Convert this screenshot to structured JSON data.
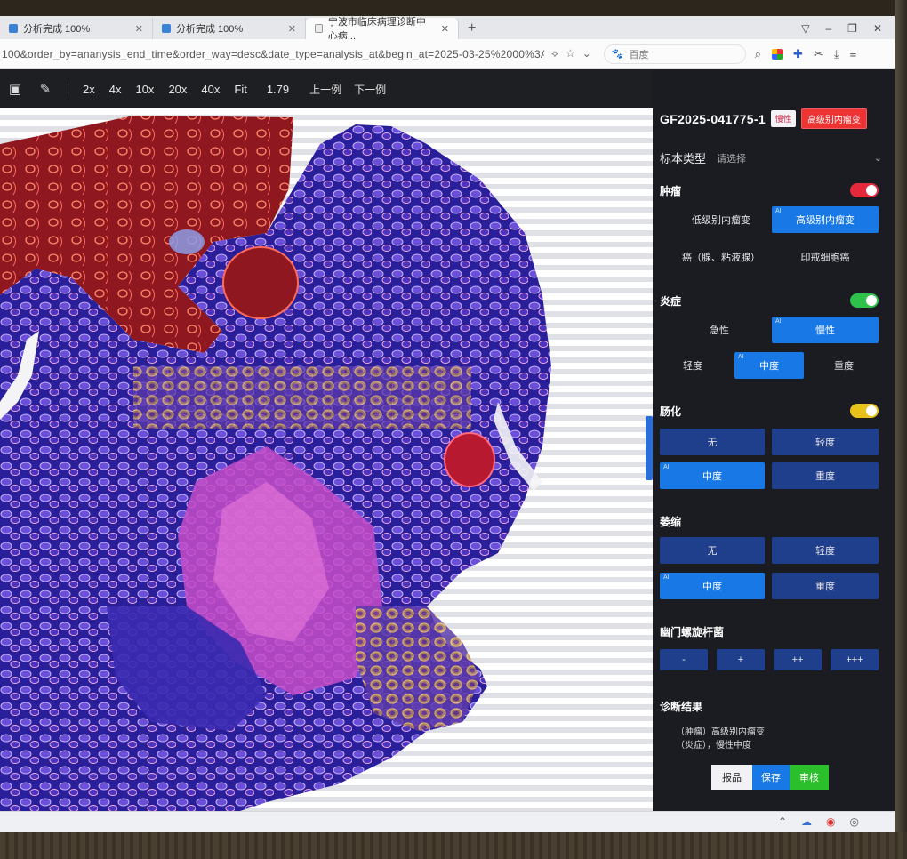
{
  "browser": {
    "tabs": [
      {
        "title": "分析完成 100%"
      },
      {
        "title": "分析完成 100%"
      },
      {
        "title": "宁波市临床病理诊断中心病..."
      }
    ],
    "url": "100&order_by=ananysis_end_time&order_way=desc&date_type=analysis_at&begin_at=2025-03-25%2000%3A001",
    "search_placeholder": "百度"
  },
  "toolbar": {
    "zoom_buttons": [
      "2x",
      "4x",
      "10x",
      "20x",
      "40x",
      "Fit"
    ],
    "zoom_value": "1.79",
    "prev_label": "上一例",
    "next_label": "下一例"
  },
  "panel": {
    "case_id": "GF2025-041775-1",
    "tag_chronic": "慢性",
    "tag_diagnosis": "高级别内瘤变",
    "specimen_label": "标本类型",
    "specimen_value": "请选择",
    "tumor": {
      "title": "肿瘤",
      "options": [
        "低级别内瘤变",
        "高级别内瘤变",
        "癌（腺、粘液腺）",
        "印戒细胞癌"
      ],
      "selected_index": 1
    },
    "inflammation": {
      "title": "炎症",
      "type_options": [
        "急性",
        "慢性"
      ],
      "type_selected": 1,
      "severity_options": [
        "轻度",
        "中度",
        "重度"
      ],
      "severity_selected": 1
    },
    "metaplasia": {
      "title": "肠化",
      "options": [
        "无",
        "轻度",
        "中度",
        "重度"
      ],
      "selected_index": 2
    },
    "atrophy": {
      "title": "萎缩",
      "options": [
        "无",
        "轻度",
        "中度",
        "重度"
      ],
      "selected_index": 2
    },
    "hp": {
      "title": "幽门螺旋杆菌",
      "options": [
        "-",
        "+",
        "++",
        "+++"
      ]
    },
    "result": {
      "title": "诊断结果",
      "line1": "（肿瘤）高级别内瘤变",
      "line2": "（炎症），慢性中度"
    },
    "actions": {
      "report": "报品",
      "save": "保存",
      "submit": "审核"
    },
    "ai_tag": "AI"
  },
  "colors": {
    "selected": "#1778e6",
    "option_block": "#1f3f8c",
    "toggle_tumor": "#e5293a",
    "toggle_inflammation": "#2ec24a",
    "toggle_metaplasia": "#e6c21a",
    "tag_red": "#e33333",
    "submit_green": "#2bbf2b"
  }
}
